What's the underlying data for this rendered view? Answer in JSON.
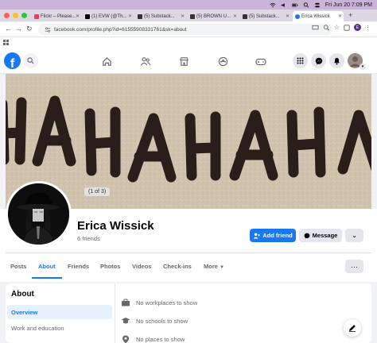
{
  "system": {
    "date_time": "Fri Jun 20  7:09 PM",
    "colors": {
      "menubar": "#c9b3d6"
    }
  },
  "browser": {
    "tabs": [
      {
        "title": "Flickr – Please...",
        "favicon": "flickr-icon"
      },
      {
        "title": "(1) EVW (@Th...",
        "favicon": "x-icon"
      },
      {
        "title": "(5) Substack...",
        "favicon": "substack-icon"
      },
      {
        "title": "(5) BROWN U...",
        "favicon": "substack-icon"
      },
      {
        "title": "(5) Substack...",
        "favicon": "substack-icon"
      },
      {
        "title": "Erica Wissick",
        "favicon": "facebook-icon",
        "active": true
      }
    ],
    "url": "facebook.com/profile.php?id=61555908331761&sk=about",
    "profile_initial": "E"
  },
  "facebook": {
    "brand_color": "#1877f2",
    "logo_letter": "f"
  },
  "cover": {
    "photo_counter": "(1 of 3)",
    "photo_text": "HAHAHAH"
  },
  "profile": {
    "name": "Erica Wissick",
    "friends": "6 friends",
    "add_friend_label": "Add friend",
    "message_label": "Message"
  },
  "profile_tabs": [
    {
      "label": "Posts"
    },
    {
      "label": "About",
      "active": true
    },
    {
      "label": "Friends"
    },
    {
      "label": "Photos"
    },
    {
      "label": "Videos"
    },
    {
      "label": "Check-ins"
    },
    {
      "label": "More"
    }
  ],
  "about": {
    "title": "About",
    "nav": [
      "Overview",
      "Work and education"
    ],
    "rows": [
      {
        "icon": "briefcase-icon",
        "text": "No workplaces to show"
      },
      {
        "icon": "graduation-cap-icon",
        "text": "No schools to show"
      },
      {
        "icon": "location-pin-icon",
        "text": "No places to show"
      }
    ]
  }
}
